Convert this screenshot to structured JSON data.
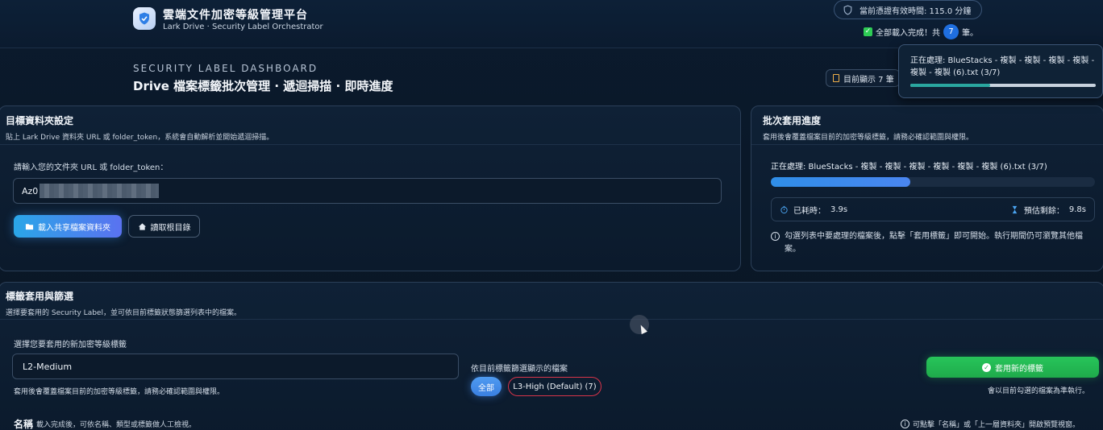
{
  "app": {
    "title": "雲端文件加密等級管理平台",
    "subtitle": "Lark Drive · Security Label Orchestrator",
    "credential_text": "當前憑證有效時間: 115.0 分鐘",
    "loaded_prefix": "全部載入完成！共",
    "loaded_count": "7",
    "loaded_suffix": "筆。"
  },
  "dashboard": {
    "kicker": "SECURITY LABEL DASHBOARD",
    "title": "Drive 檔案標籤批次管理 · 遞迴掃描 · 即時進度",
    "showing_label": "目前顯示 7 筆"
  },
  "toast": {
    "text": "正在處理: BlueStacks - 複製 - 複製 - 複製 - 複製 - 複製 - 複製 (6).txt (3/7)",
    "progress": 0.43
  },
  "target_folder": {
    "title": "目標資料夾設定",
    "desc": "貼上 Lark Drive 資料夾 URL 或 folder_token，系統會自動解析並開始遞迴掃描。",
    "input_label": "請輸入您的文件夾 URL 或 folder_token：",
    "input_value": "Az0",
    "load_button": "載入共享檔案資料夾",
    "root_button": "讀取根目錄"
  },
  "batch_progress": {
    "title": "批次套用進度",
    "desc": "套用後會覆蓋檔案目前的加密等級標籤，請務必確認範圍與權限。",
    "processing_text": "正在處理: BlueStacks - 複製 - 複製 - 複製 - 複製 - 複製 - 複製 (6).txt (3/7)",
    "progress": 0.43,
    "elapsed_label": "已耗時：",
    "elapsed_value": "3.9s",
    "remaining_label": "預估剩餘：",
    "remaining_value": "9.8s",
    "note": "勾選列表中要處理的檔案後，點擊「套用標籤」即可開始。執行期間仍可瀏覽其他檔案。"
  },
  "labels": {
    "title": "標籤套用與篩選",
    "desc": "選擇要套用的 Security Label，並可依目前標籤狀態篩選列表中的檔案。",
    "select_label": "選擇您要套用的新加密等級標籤",
    "select_value": "L2-Medium",
    "select_help": "套用後會覆蓋檔案目前的加密等級標籤，請務必確認範圍與權限。",
    "filter_label": "依目前標籤篩選顯示的檔案",
    "chip_all": "全部",
    "chip_high": "L3-High (Default) (7)",
    "apply_button": "套用新的標籤",
    "apply_help": "會以目前勾選的檔案為準執行。",
    "name_title": "名稱",
    "name_desc": "載入完成後，可依名稱、類型或標籤做人工檢視。",
    "name_note": "可點擊「名稱」或「上一層資料夾」開啟預覽視窗。"
  },
  "colors": {
    "accent_blue": "#2f8ee8",
    "success_green": "#27c55a",
    "danger_red": "#d9344a"
  }
}
